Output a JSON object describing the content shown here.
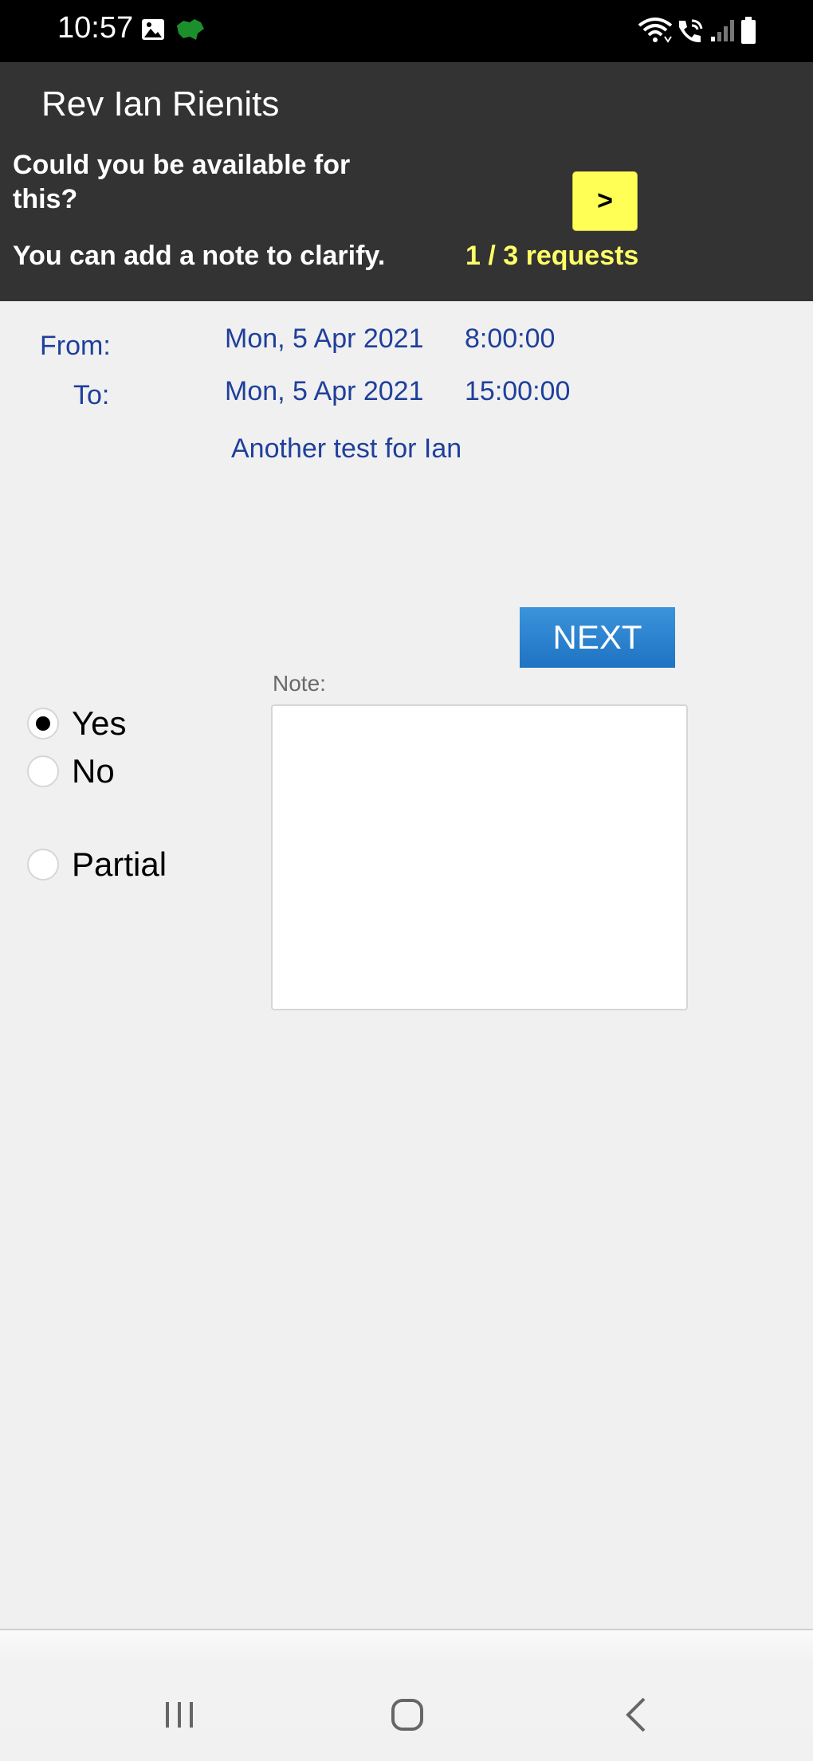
{
  "status_bar": {
    "time": "10:57",
    "icons": [
      "gallery-icon",
      "app-notification-icon",
      "wifi-icon",
      "wifi-calling-icon",
      "signal-icon",
      "battery-icon"
    ]
  },
  "header": {
    "name": "Rev Ian Rienits",
    "question": "Could you be available for this?",
    "note_hint": "You can add a note to clarify.",
    "next_request_label": ">",
    "request_counter": "1 / 3 requests"
  },
  "details": {
    "from_label": "From:",
    "to_label": "To:",
    "from_date": "Mon, 5 Apr 2021",
    "from_time": "8:00:00",
    "to_date": "Mon, 5 Apr 2021",
    "to_time": "15:00:00",
    "description": "Another test for Ian"
  },
  "next_button_label": "NEXT",
  "note": {
    "label": "Note:",
    "value": ""
  },
  "availability": {
    "selected": "Yes",
    "options": [
      "Yes",
      "No",
      "Partial"
    ]
  },
  "colors": {
    "header_bg": "#333333",
    "accent_yellow": "#ffff55",
    "text_blue": "#1f3f9b",
    "next_button_blue": "#2a82cf"
  },
  "nav_bar": {
    "icons": [
      "recents-icon",
      "home-icon",
      "back-icon"
    ]
  }
}
